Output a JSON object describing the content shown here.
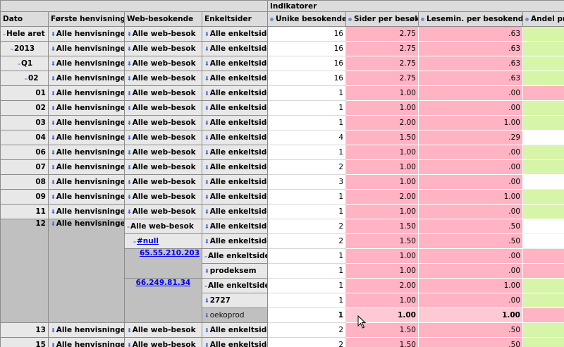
{
  "header": {
    "indicators_label": "Indikatorer",
    "cols": [
      "Dato",
      "Første henvisning",
      "Web-besokende",
      "Enkeltsider"
    ],
    "measures": [
      "Unike besokende",
      "Sider per besøk",
      "Lesemin. per besokende",
      "Andel pr"
    ]
  },
  "rows": [
    {
      "dato": "Hele aret",
      "hen": "Alle henvisninger",
      "web": "Alle web-besok",
      "enk": "Alle enkeltsider",
      "u": "16",
      "s": "2.75",
      "l": ".63",
      "a": "green"
    },
    {
      "dato": "2013",
      "hen": "Alle henvisninger",
      "web": "Alle web-besok",
      "enk": "Alle enkeltsider",
      "u": "16",
      "s": "2.75",
      "l": ".63",
      "a": "green"
    },
    {
      "dato": "Q1",
      "hen": "Alle henvisninger",
      "web": "Alle web-besok",
      "enk": "Alle enkeltsider",
      "u": "16",
      "s": "2.75",
      "l": ".63",
      "a": "green"
    },
    {
      "dato": "02",
      "hen": "Alle henvisninger",
      "web": "Alle web-besok",
      "enk": "Alle enkeltsider",
      "u": "16",
      "s": "2.75",
      "l": ".63",
      "a": "green"
    },
    {
      "dato": "01",
      "hen": "Alle henvisninger",
      "web": "Alle web-besok",
      "enk": "Alle enkeltsider",
      "u": "1",
      "s": "1.00",
      "l": ".00",
      "a": "red"
    },
    {
      "dato": "02",
      "hen": "Alle henvisninger",
      "web": "Alle web-besok",
      "enk": "Alle enkeltsider",
      "u": "1",
      "s": "1.00",
      "l": ".00",
      "a": "green"
    },
    {
      "dato": "03",
      "hen": "Alle henvisninger",
      "web": "Alle web-besok",
      "enk": "Alle enkeltsider",
      "u": "1",
      "s": "2.00",
      "l": "1.00",
      "a": "green"
    },
    {
      "dato": "04",
      "hen": "Alle henvisninger",
      "web": "Alle web-besok",
      "enk": "Alle enkeltsider",
      "u": "4",
      "s": "1.50",
      "l": ".29",
      "a": "white"
    },
    {
      "dato": "06",
      "hen": "Alle henvisninger",
      "web": "Alle web-besok",
      "enk": "Alle enkeltsider",
      "u": "1",
      "s": "1.00",
      "l": ".00",
      "a": "green"
    },
    {
      "dato": "07",
      "hen": "Alle henvisninger",
      "web": "Alle web-besok",
      "enk": "Alle enkeltsider",
      "u": "2",
      "s": "1.00",
      "l": ".00",
      "a": "green"
    },
    {
      "dato": "08",
      "hen": "Alle henvisninger",
      "web": "Alle web-besok",
      "enk": "Alle enkeltsider",
      "u": "3",
      "s": "1.00",
      "l": ".00",
      "a": "white"
    },
    {
      "dato": "09",
      "hen": "Alle henvisninger",
      "web": "Alle web-besok",
      "enk": "Alle enkeltsider",
      "u": "1",
      "s": "2.00",
      "l": "1.00",
      "a": "green"
    },
    {
      "dato": "11",
      "hen": "Alle henvisninger",
      "web": "Alle web-besok",
      "enk": "Alle enkeltsider",
      "u": "1",
      "s": "1.00",
      "l": ".00",
      "a": "green"
    }
  ],
  "block12": {
    "dato": "12",
    "hen": "Alle henvisninger",
    "web": "Alle web-besok",
    "null_link": "#null",
    "ip1": "65.55.210.203",
    "ip2": "66.249.81.34",
    "enk": [
      "Alle enkeltsider",
      "Alle enkeltsider",
      "Alle enkeltsider",
      "prodeksem",
      "Alle enkeltsider",
      "2727",
      "oekoprod"
    ],
    "u": [
      "2",
      "2",
      "1",
      "1",
      "1",
      "1",
      "1"
    ],
    "s": [
      "1.50",
      "1.50",
      "1.00",
      "1.00",
      "2.00",
      "1.00",
      "1.00"
    ],
    "l": [
      ".50",
      ".50",
      ".00",
      ".00",
      "1.00",
      ".00",
      "1.00"
    ],
    "a": [
      "white",
      "white",
      "red",
      "red",
      "green",
      "green",
      "red"
    ]
  },
  "tail": [
    {
      "dato": "13",
      "hen": "Alle henvisninger",
      "web": "Alle web-besok",
      "enk": "Alle enkeltsider",
      "u": "2",
      "s": "1.50",
      "l": ".50",
      "a": "green"
    },
    {
      "dato": "15",
      "hen": "Alle henvisninger",
      "web": "Alle web-besok",
      "enk": "Alle enkeltsider",
      "u": "2",
      "s": "1.50",
      "l": ".50",
      "a": "green"
    }
  ],
  "icons": {
    "toggle": "arrow-toggle-icon",
    "collapse": "minus-icon",
    "cursor": "mouse-pointer-icon"
  }
}
